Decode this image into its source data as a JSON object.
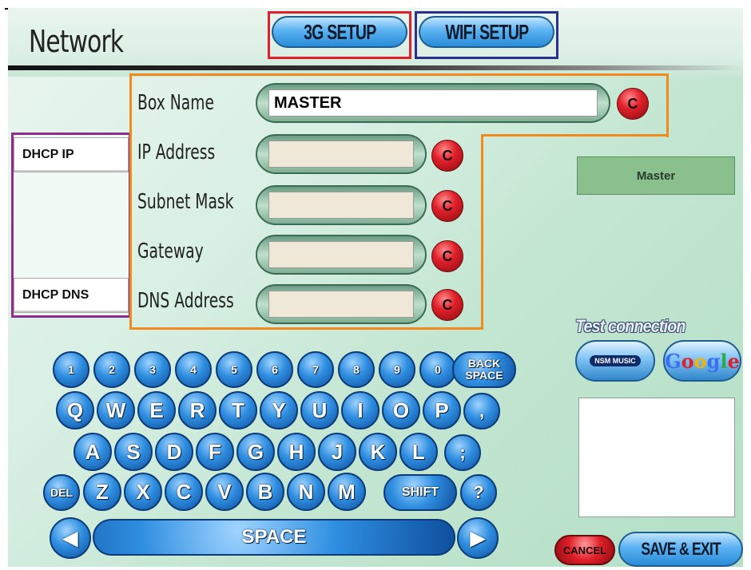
{
  "screen": {
    "title": "Network",
    "tabs": {
      "setup_3g": "3G SETUP",
      "setup_wifi": "WIFI SETUP"
    }
  },
  "dhcp": {
    "ip": "DHCP IP",
    "dns": "DHCP DNS"
  },
  "fields": [
    {
      "label": "Box Name",
      "value": "MASTER",
      "clear": "C"
    },
    {
      "label": "IP Address",
      "value": "",
      "clear": "C"
    },
    {
      "label": "Subnet Mask",
      "value": "",
      "clear": "C"
    },
    {
      "label": "Gateway",
      "value": "",
      "clear": "C"
    },
    {
      "label": "DNS Address",
      "value": "",
      "clear": "C"
    }
  ],
  "sidebar": {
    "device": "Master",
    "test_connection": "Test connection",
    "nsm_logo": "NSM MUSIC",
    "google_logo": "Google"
  },
  "keyboard": {
    "row1": [
      "1",
      "2",
      "3",
      "4",
      "5",
      "6",
      "7",
      "8",
      "9",
      "0"
    ],
    "backspace": "BACK SPACE",
    "row2": [
      "Q",
      "W",
      "E",
      "R",
      "T",
      "Y",
      "U",
      "I",
      "O",
      "P"
    ],
    "row2_extra": ",",
    "row3": [
      "A",
      "S",
      "D",
      "F",
      "G",
      "H",
      "J",
      "K",
      "L"
    ],
    "row3_extra": ";",
    "del": "DEL",
    "row4": [
      "Z",
      "X",
      "C",
      "V",
      "B",
      "N",
      "M"
    ],
    "shift": "SHIFT",
    "row4_extra": "?",
    "space": "SPACE"
  },
  "actions": {
    "cancel": "CANCEL",
    "save_exit": "SAVE & EXIT"
  },
  "colors": {
    "annotation_red": "#e0202a",
    "annotation_navy": "#2c2f8e",
    "annotation_purple": "#8e2c8f",
    "annotation_orange": "#f08a1c"
  }
}
